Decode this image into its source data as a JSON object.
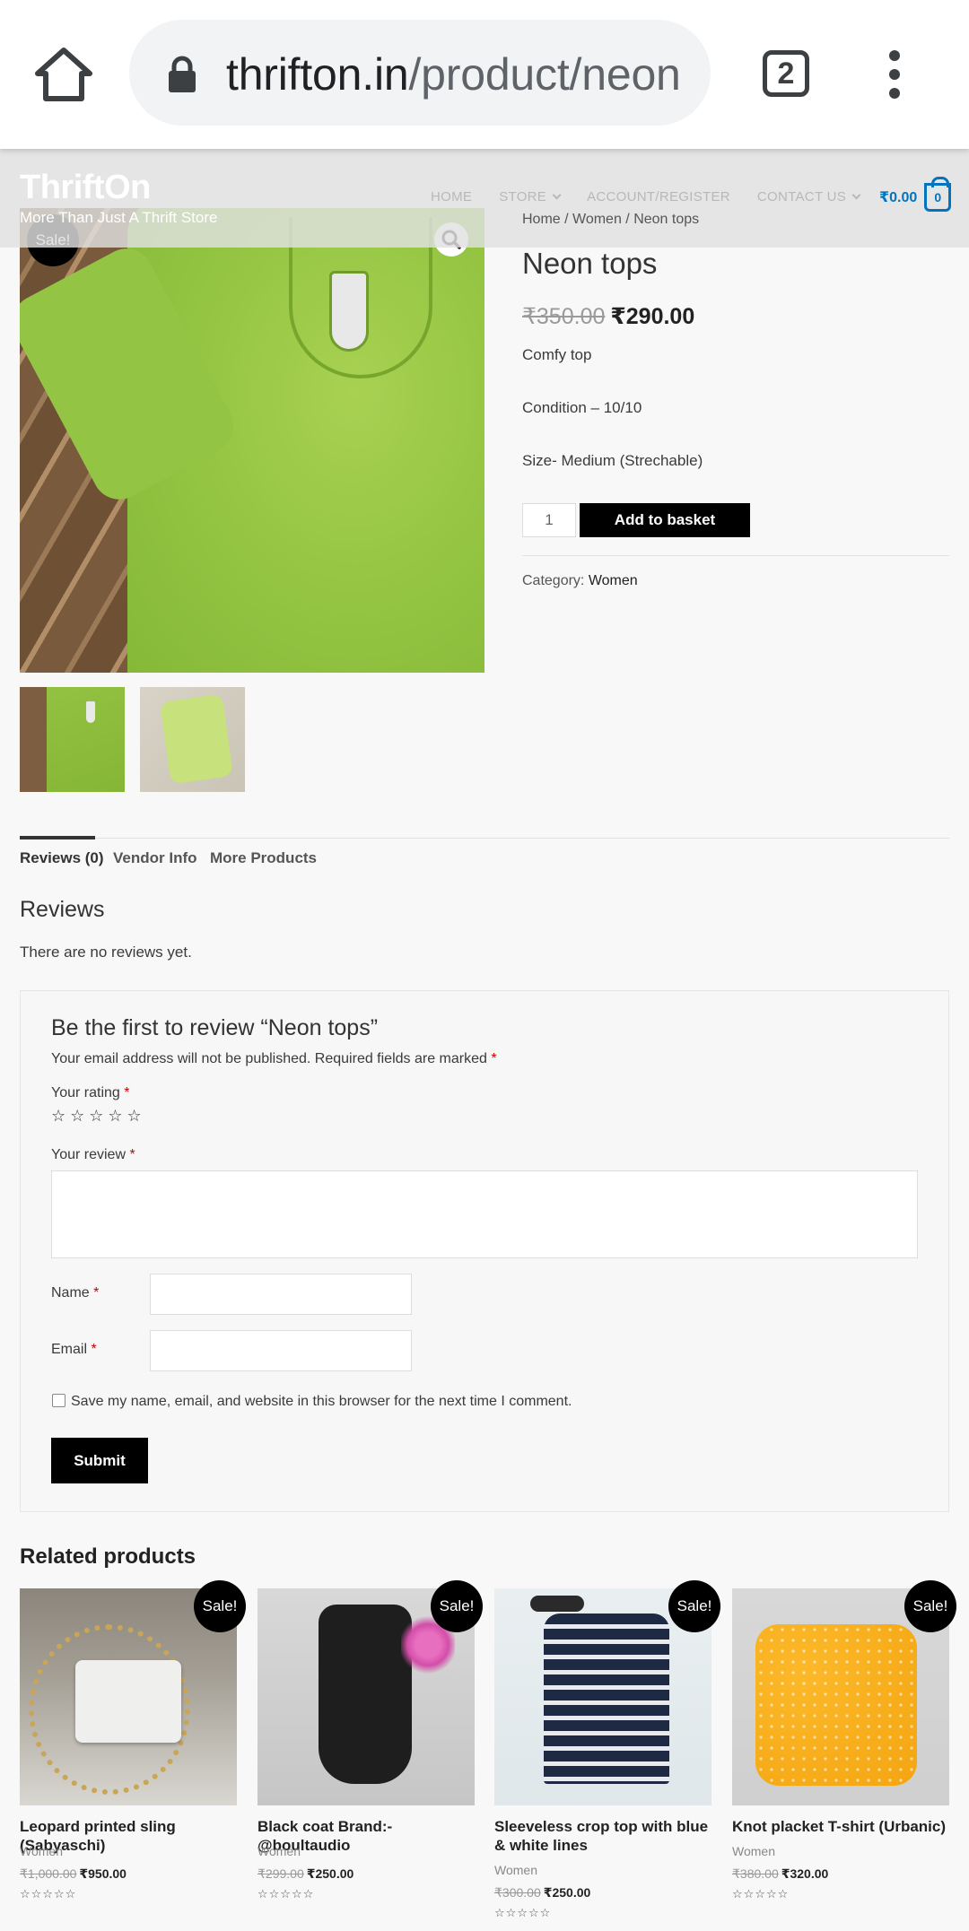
{
  "browser": {
    "url_host": "thrifton.in",
    "url_path": "/product/neon",
    "tab_count": "2"
  },
  "site": {
    "logo": "ThriftOn",
    "tagline": "More Than Just A Thrift Store",
    "nav": [
      "HOME",
      "STORE",
      "ACCOUNT/REGISTER",
      "CONTACT US"
    ],
    "cart_total": "₹0.00",
    "cart_count": "0"
  },
  "product": {
    "sale_badge": "Sale!",
    "breadcrumb": "Home / Women / Neon tops",
    "title": "Neon tops",
    "old_price": "₹350.00",
    "new_price": "₹290.00",
    "description": [
      "Comfy top",
      "Condition – 10/10",
      "Size- Medium (Strechable)"
    ],
    "quantity": "1",
    "add_to_basket": "Add to basket",
    "category_label": "Category:",
    "category": "Women"
  },
  "tabs": [
    "Reviews (0)",
    "Vendor Info",
    "More Products"
  ],
  "reviews": {
    "heading": "Reviews",
    "empty_text": "There are no reviews yet."
  },
  "review_form": {
    "title": "Be the first to review “Neon tops”",
    "note": "Your email address will not be published. Required fields are marked",
    "required_mark": "*",
    "rating_label": "Your rating",
    "review_label": "Your review",
    "name_label": "Name",
    "email_label": "Email",
    "cookies_label": "Save my name, email, and website in this browser for the next time I comment.",
    "submit": "Submit",
    "stars": "☆ ☆ ☆ ☆ ☆"
  },
  "related": {
    "heading": "Related products",
    "products": [
      {
        "name": "Leopard printed sling (Sabyaschi)",
        "category": "Women",
        "old_price": "₹1,000.00",
        "new_price": "₹950.00",
        "badge": "Sale!",
        "stars": "☆☆☆☆☆"
      },
      {
        "name": "Black coat Brand:- @boultaudio",
        "category": "Women",
        "old_price": "₹299.00",
        "new_price": "₹250.00",
        "badge": "Sale!",
        "stars": "☆☆☆☆☆"
      },
      {
        "name": "Sleeveless crop top with blue & white lines",
        "category": "Women",
        "old_price": "₹300.00",
        "new_price": "₹250.00",
        "badge": "Sale!",
        "stars": "☆☆☆☆☆"
      },
      {
        "name": "Knot placket T-shirt (Urbanic)",
        "category": "Women",
        "old_price": "₹380.00",
        "new_price": "₹320.00",
        "badge": "Sale!",
        "stars": "☆☆☆☆☆"
      }
    ]
  },
  "colors": {
    "accent": "#0274be",
    "button": "#000000",
    "product_green": "#8cbc3c"
  }
}
